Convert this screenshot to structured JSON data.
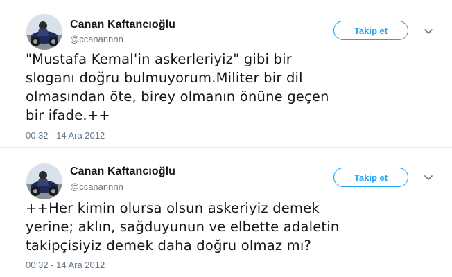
{
  "tweets": [
    {
      "author_name": "Canan Kaftancıoğlu",
      "author_handle": "@ccanannnn",
      "follow_label": "Takip et",
      "text": "\"Mustafa Kemal'in askerleriyiz\" gibi bir\nsloganı doğru bulmuyorum.Militer bir dil\nolmasından öte, birey olmanın önüne geçen\nbir ifade.++",
      "timestamp": "00:32 - 14 Ara 2012"
    },
    {
      "author_name": "Canan Kaftancıoğlu",
      "author_handle": "@ccanannnn",
      "follow_label": "Takip et",
      "text": "++Her kimin olursa olsun askeriyiz demek\nyerine; aklın, sağduyunun ve elbette adaletin\ntakipçisiyiz demek daha  doğru olmaz mı?",
      "timestamp": "00:32 - 14 Ara 2012"
    }
  ],
  "colors": {
    "accent": "#1da1f2",
    "secondary_text": "#657786",
    "primary_text": "#14171a",
    "divider": "#e6ecf0"
  },
  "icons": {
    "avatar": "avatar-photo-motorcycle",
    "menu": "chevron-down-icon"
  }
}
